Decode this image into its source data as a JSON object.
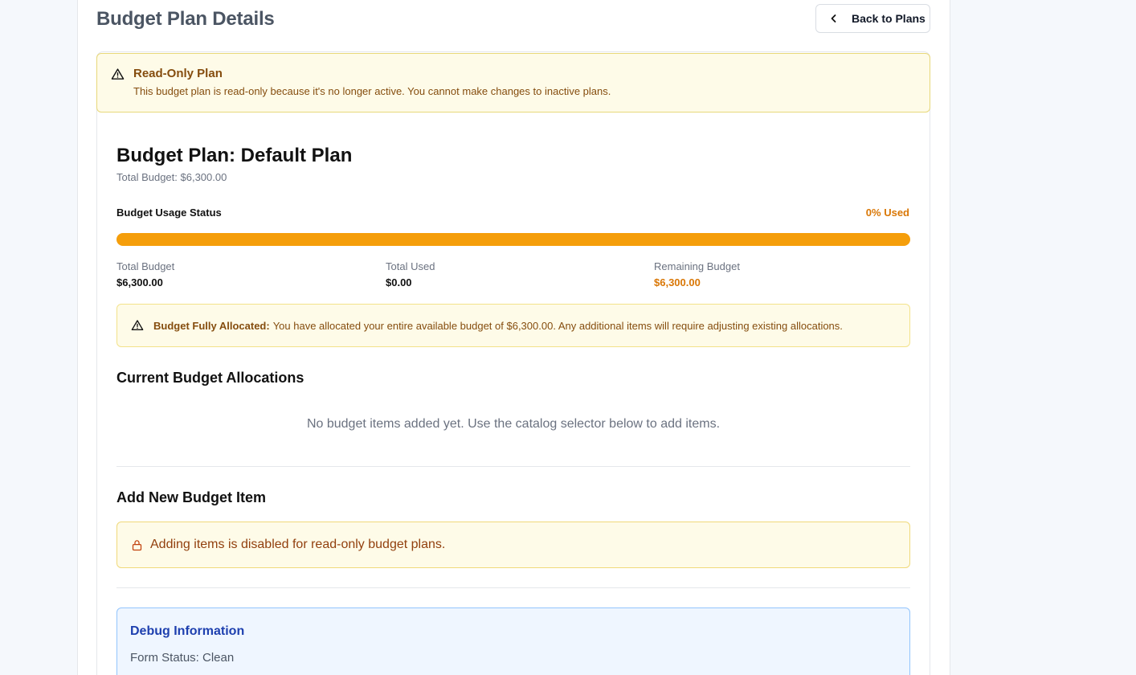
{
  "header": {
    "title": "Budget Plan Details",
    "back_label": "Back to Plans"
  },
  "readonly_alert": {
    "title": "Read-Only Plan",
    "message": "This budget plan is read-only because it's no longer active. You cannot make changes to inactive plans."
  },
  "plan": {
    "name": "Budget Plan: Default Plan",
    "total_text": "Total Budget: $6,300.00"
  },
  "usage": {
    "label": "Budget Usage Status",
    "percent_text": "0% Used",
    "percent_used": 0,
    "stats": [
      {
        "label": "Total Budget",
        "value": "$6,300.00"
      },
      {
        "label": "Total Used",
        "value": "$0.00"
      },
      {
        "label": "Remaining Budget",
        "value": "$6,300.00"
      }
    ]
  },
  "alloc_alert": {
    "bold": "Budget Fully Allocated:",
    "message": "You have allocated your entire available budget of $6,300.00. Any additional items will require adjusting existing allocations."
  },
  "allocations": {
    "title": "Current Budget Allocations",
    "empty_message": "No budget items added yet. Use the catalog selector below to add items."
  },
  "add_item": {
    "title": "Add New Budget Item",
    "disabled_message": "Adding items is disabled for read-only budget plans."
  },
  "debug": {
    "title": "Debug Information",
    "form_status": "Form Status: Clean"
  },
  "colors": {
    "warning_text": "#854d0e",
    "progress": "#f59e0b",
    "accent_orange": "#d97706",
    "debug_blue": "#1e40af"
  },
  "icons": {
    "back": "chevron-left-icon",
    "warning": "warning-triangle-icon",
    "lock": "lock-icon"
  }
}
